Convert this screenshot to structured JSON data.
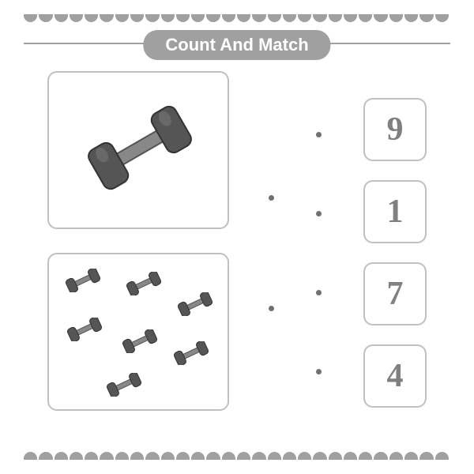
{
  "title": "Count And Match",
  "boxes": [
    {
      "count": 1
    },
    {
      "count": 7
    }
  ],
  "numbers": [
    "9",
    "1",
    "7",
    "4"
  ],
  "item_name": "dumbbell",
  "colors": {
    "accent": "#a0a0a0",
    "number_text": "#808080",
    "box_border": "#c0c0c0"
  }
}
